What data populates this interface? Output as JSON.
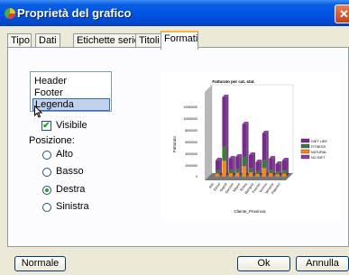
{
  "window": {
    "title": "Proprietà del grafico",
    "close_glyph": "✕"
  },
  "tabs": [
    {
      "label": "Tipo"
    },
    {
      "label": "Dati"
    },
    {
      "label": "Etichette serie"
    },
    {
      "label": "Titoli"
    },
    {
      "label": "Formati",
      "active": true
    }
  ],
  "element_list": [
    "Header",
    "Footer",
    "Legenda"
  ],
  "selected_element": "Legenda",
  "visible_checkbox": {
    "label": "Visibile",
    "checked": true,
    "mark": "✔"
  },
  "position": {
    "label": "Posizione:",
    "options": [
      "Alto",
      "Basso",
      "Destra",
      "Sinistra"
    ],
    "selected": "Destra"
  },
  "chart_preview": {
    "title": "Fatturato per cat. stat.",
    "ylabel": "Fatturato",
    "xlabel": "Cliente_Provincia",
    "y_ticks": [
      "12000000",
      "10000000",
      "8000000",
      "6000000",
      "4000000",
      "2000000",
      "0"
    ],
    "categories": [
      "Asti",
      "Torino",
      "Napoli",
      "Genova",
      "Milano",
      "Roma",
      "Bologna",
      "Firenze",
      "Verona",
      "Venezia",
      "Palermo"
    ],
    "legend": [
      "DIET LIKE",
      "FITNESS",
      "NATURAL",
      "NO DIET"
    ],
    "colors": {
      "diet_like": "#7a2a8c",
      "fitness": "#3b7a3b",
      "natural": "#f08a1e",
      "no_diet": "#8e3fa8"
    }
  },
  "buttons": {
    "normale": "Normale",
    "ok": "Ok",
    "annulla": "Annulla"
  }
}
